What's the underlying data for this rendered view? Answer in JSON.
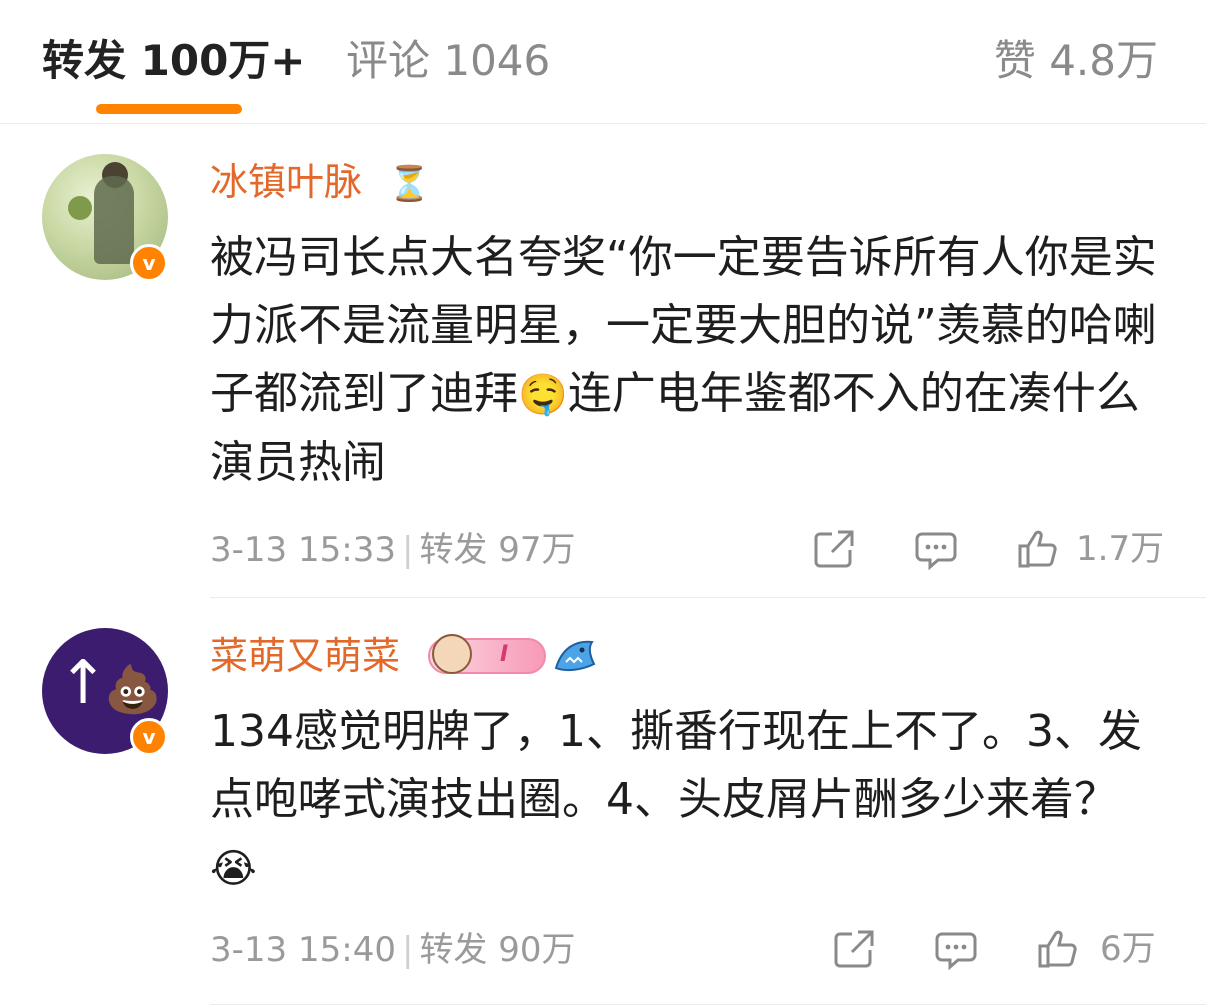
{
  "tabs": {
    "repost": "转发 100万+",
    "comment": "评论 1046",
    "like": "赞 4.8万"
  },
  "colors": {
    "accent": "#ff8200",
    "username": "#e3692a",
    "meta": "#9a9a9a"
  },
  "comments": [
    {
      "username": "冰镇叶脉",
      "badges": [
        "hourglass-icon"
      ],
      "verified": "v",
      "text_before_emoji": "被冯司长点大名夸奖“你一定要告诉所有人你是实力派不是流量明星，一定要大胆的说”羡慕的哈喇子都流到了迪拜",
      "emoji": "🤤",
      "text_after_emoji": "连广电年鉴都不入的在凑什么演员热闹",
      "time": "3-13 15:33",
      "repost": "转发 97万",
      "likes": "1.7万"
    },
    {
      "username": "菜萌又萌菜",
      "badges": [
        "fan-badge-icon",
        "shark-icon"
      ],
      "badge_text": "I",
      "verified": "v",
      "text_before_emoji": "134感觉明牌了，1、撕番行现在上不了。3、发点咆哮式演技出圈。4、头皮屑片酬多少来着？",
      "emoji": "😭",
      "text_after_emoji": "",
      "time": "3-13 15:40",
      "repost": "转发 90万",
      "likes": "6万"
    }
  ]
}
